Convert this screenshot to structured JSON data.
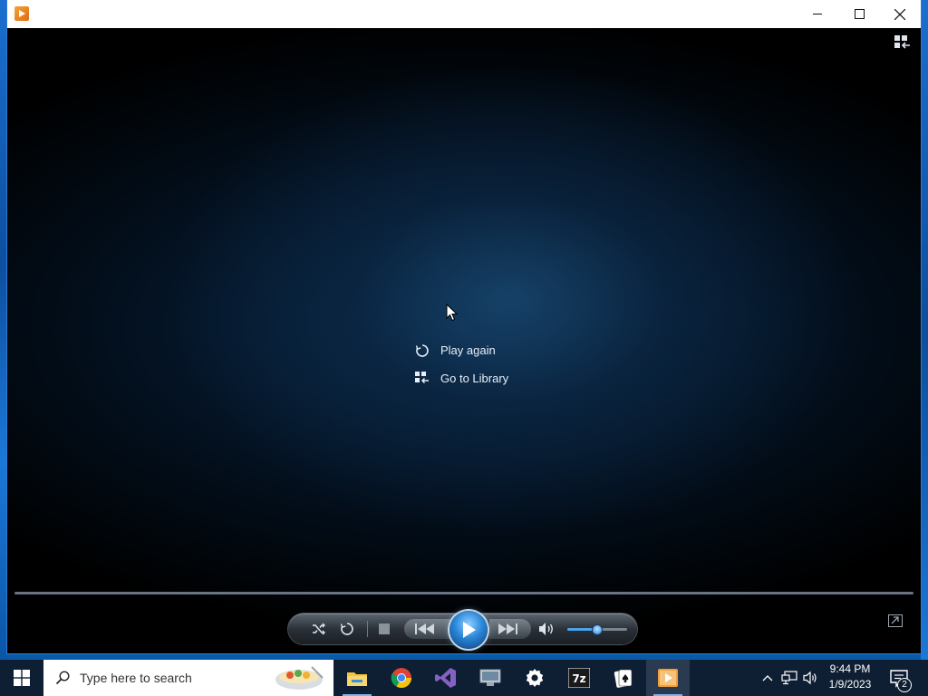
{
  "window": {
    "controls": {
      "minimize": "—",
      "maximize": "☐",
      "close": "✕"
    }
  },
  "player": {
    "menu": [
      {
        "label": "Play again",
        "icon": "replay-icon"
      },
      {
        "label": "Go to Library",
        "icon": "library-icon"
      }
    ],
    "volume_level": 0.5
  },
  "taskbar": {
    "search_placeholder": "Type here to search",
    "apps": [
      "file-explorer",
      "chrome",
      "visual-studio",
      "system-monitor",
      "settings",
      "7zip",
      "solitaire",
      "media-player"
    ],
    "clock": {
      "time": "9:44 PM",
      "date": "1/9/2023"
    },
    "notification_count": "2"
  },
  "colors": {
    "taskbar_bg": "#0f1f33",
    "accent": "#2a86d8"
  }
}
